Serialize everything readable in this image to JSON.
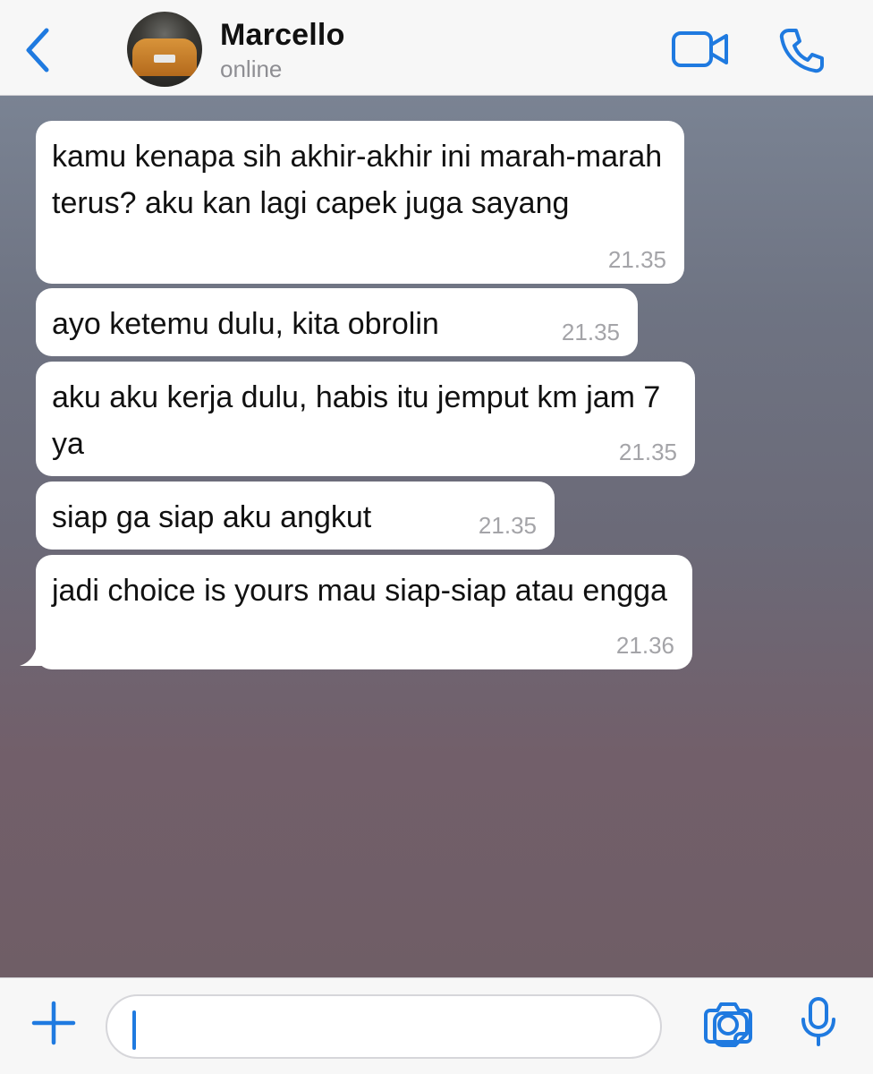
{
  "header": {
    "contact_name": "Marcello",
    "status": "online",
    "back_icon": "chevron-left-icon",
    "video_icon": "video-camera-icon",
    "call_icon": "phone-icon"
  },
  "messages": [
    {
      "text": "kamu kenapa sih akhir-akhir ini marah-marah terus? aku kan lagi capek juga sayang",
      "time": "21.35"
    },
    {
      "text": "ayo ketemu dulu, kita obrolin",
      "time": "21.35"
    },
    {
      "text": "aku aku kerja dulu, habis itu jemput km jam 7 ya",
      "time": "21.35"
    },
    {
      "text": "siap ga siap aku angkut",
      "time": "21.35"
    },
    {
      "text": "jadi choice is yours mau siap-siap atau engga",
      "time": "21.36"
    }
  ],
  "input_bar": {
    "value": "",
    "plus_icon": "plus-icon",
    "sticker_icon": "sticker-icon",
    "camera_icon": "camera-icon",
    "mic_icon": "microphone-icon"
  },
  "colors": {
    "accent": "#1f7ae0",
    "bubble": "#ffffff",
    "timestamp": "#a4a4a8"
  }
}
